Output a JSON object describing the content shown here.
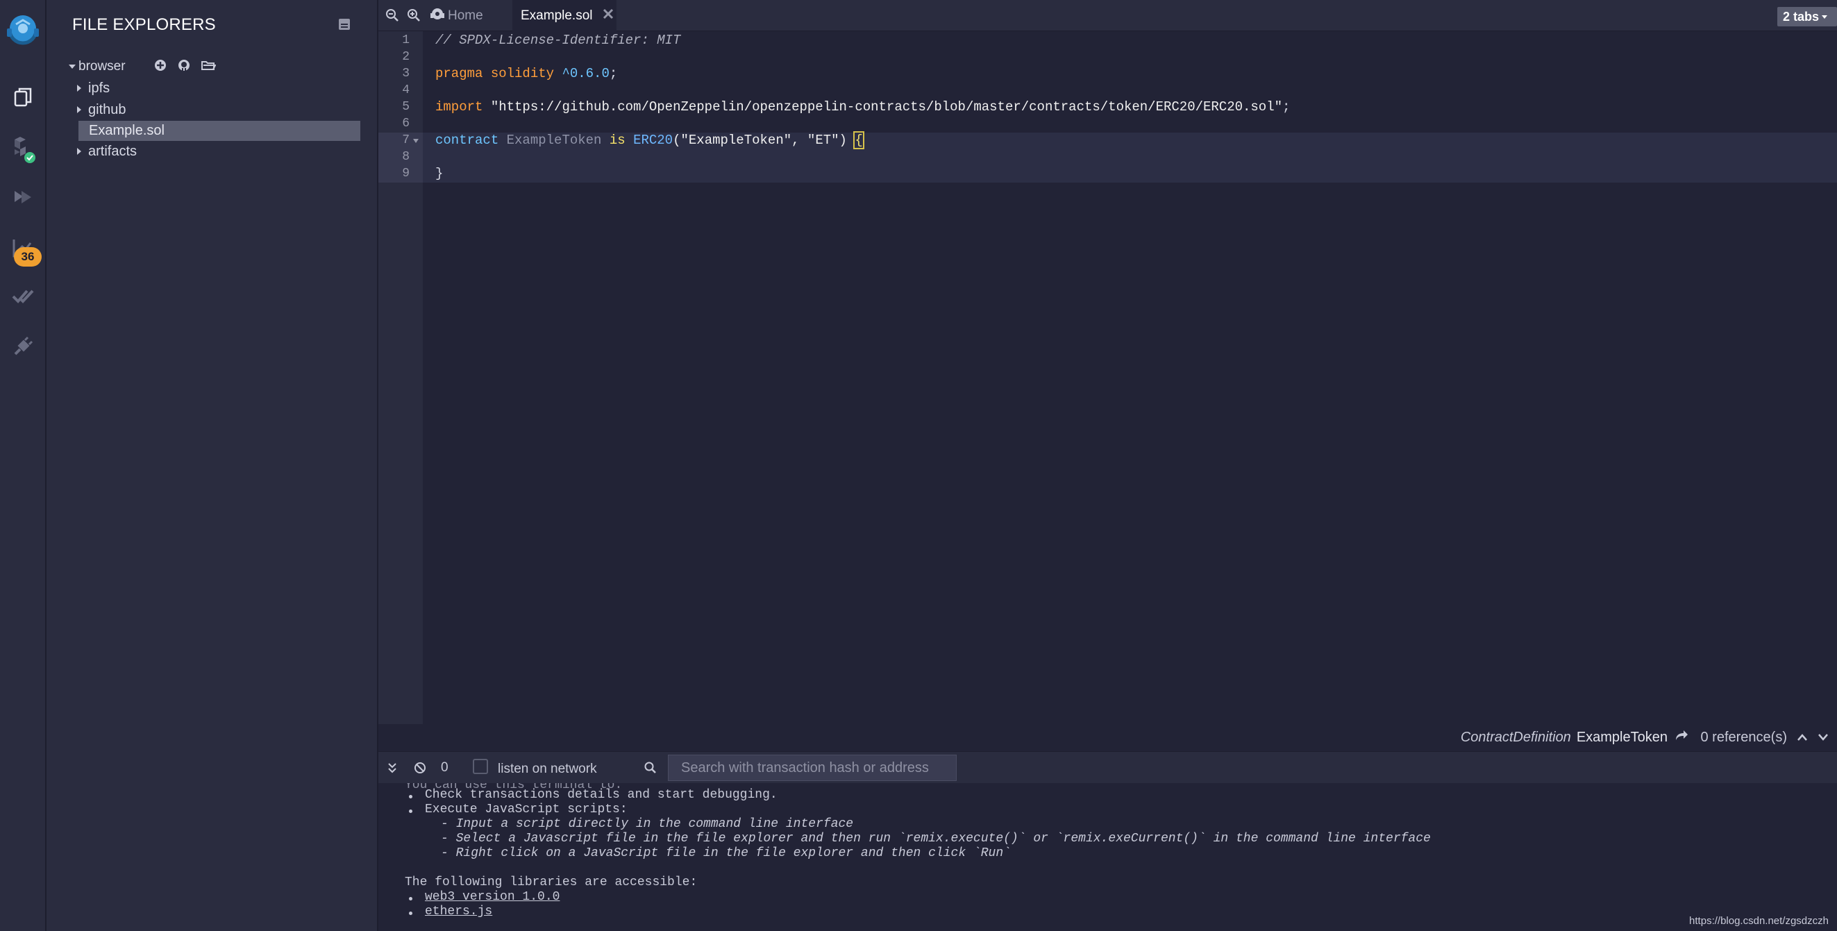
{
  "app": {
    "name": "Remix IDE"
  },
  "icon_panel": {
    "items": [
      {
        "name": "remix-logo",
        "icon": "remix-logo-icon"
      },
      {
        "name": "file-explorers",
        "icon": "files-icon"
      },
      {
        "name": "solidity-compiler",
        "icon": "solidity-icon",
        "status": "ok"
      },
      {
        "name": "deploy-run",
        "icon": "deploy-icon"
      },
      {
        "name": "analysis",
        "icon": "analysis-icon",
        "badge": "36"
      },
      {
        "name": "testing",
        "icon": "double-check-icon"
      },
      {
        "name": "plugin-manager",
        "icon": "plug-icon"
      }
    ],
    "badge_color": "#f0a030",
    "status_color": "#3ec183"
  },
  "side_panel": {
    "title": "FILE EXPLORERS",
    "root": {
      "label": "browser"
    },
    "items": [
      {
        "label": "ipfs",
        "type": "folder"
      },
      {
        "label": "github",
        "type": "folder"
      },
      {
        "label": "Example.sol",
        "type": "file",
        "selected": true
      },
      {
        "label": "artifacts",
        "type": "folder"
      }
    ]
  },
  "tabs": {
    "home_label": "Home",
    "active_label": "Example.sol",
    "count_label": "2 tabs"
  },
  "editor": {
    "line_numbers": [
      "1",
      "2",
      "3",
      "4",
      "5",
      "6",
      "7",
      "8",
      "9"
    ],
    "lines": {
      "l1": "// SPDX-License-Identifier: MIT",
      "l3_kw": "pragma solidity",
      "l3_ver": "^0.6.0",
      "l3_end": ";",
      "l5_kw": "import",
      "l5_str": "\"https://github.com/OpenZeppelin/openzeppelin-contracts/blob/master/contracts/token/ERC20/ERC20.sol\"",
      "l5_end": ";",
      "l7_kw": "contract",
      "l7_name": "ExampleToken",
      "l7_is": "is",
      "l7_erc": "ERC20",
      "l7_args": "(\"ExampleToken\", \"ET\")",
      "l7_brace": "{",
      "l9": "}"
    }
  },
  "status": {
    "definition_type": "ContractDefinition",
    "definition_name": "ExampleToken",
    "references": "0 reference(s)"
  },
  "terminal": {
    "count": "0",
    "listen_label": "listen on network",
    "search_placeholder": "Search with transaction hash or address",
    "output": {
      "cut_line": "You can use this terminal to:",
      "b1": "Check transactions details and start debugging.",
      "b2": "Execute JavaScript scripts:",
      "s1": "- Input a script directly in the command line interface",
      "s2": "- Select a Javascript file in the file explorer and then run `remix.execute()` or `remix.exeCurrent()` in the command line interface",
      "s3": "- Right click on a JavaScript file in the file explorer and then click `Run`",
      "libs": "The following libraries are accessible:",
      "lib1": "web3 version 1.0.0",
      "lib2": "ethers.js"
    }
  },
  "watermark": "https://blog.csdn.net/zgsdzczh"
}
